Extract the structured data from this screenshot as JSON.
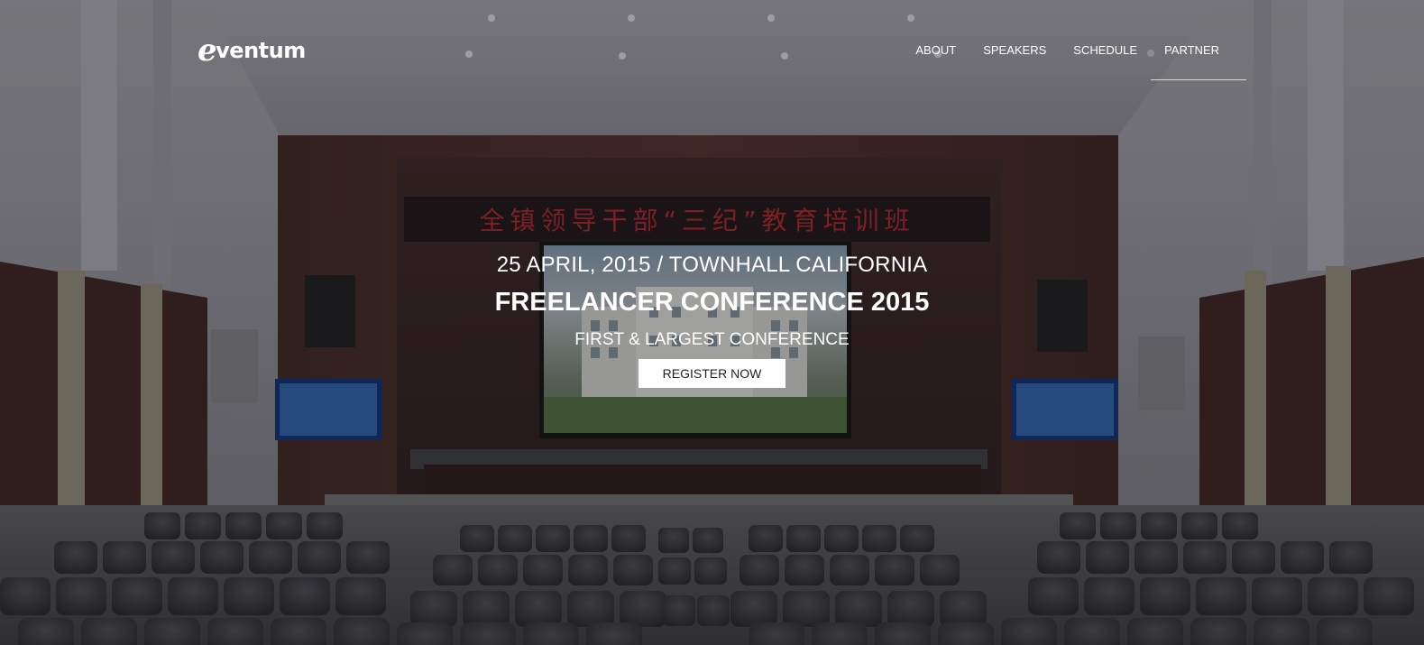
{
  "brand": {
    "logo_initial": "e",
    "logo_text": "ventum"
  },
  "nav": {
    "items": [
      {
        "label": "ABOUT"
      },
      {
        "label": "SPEAKERS"
      },
      {
        "label": "SCHEDULE"
      },
      {
        "label": "PARTNER"
      }
    ],
    "active_index": 3
  },
  "hero": {
    "date_location": "25 APRIL, 2015 / TOWNHALL CALIFORNIA",
    "title": "FREELANCER CONFERENCE 2015",
    "subtitle": "FIRST & LARGEST CONFERENCE",
    "cta_label": "REGISTER NOW"
  },
  "background": {
    "banner_text": "全镇领导干部“三纪”教育培训班"
  },
  "colors": {
    "text": "#ffffff",
    "button_bg": "#ffffff",
    "button_text": "#222222",
    "wood": "#4a2b27",
    "banner_red": "#b3282a"
  }
}
